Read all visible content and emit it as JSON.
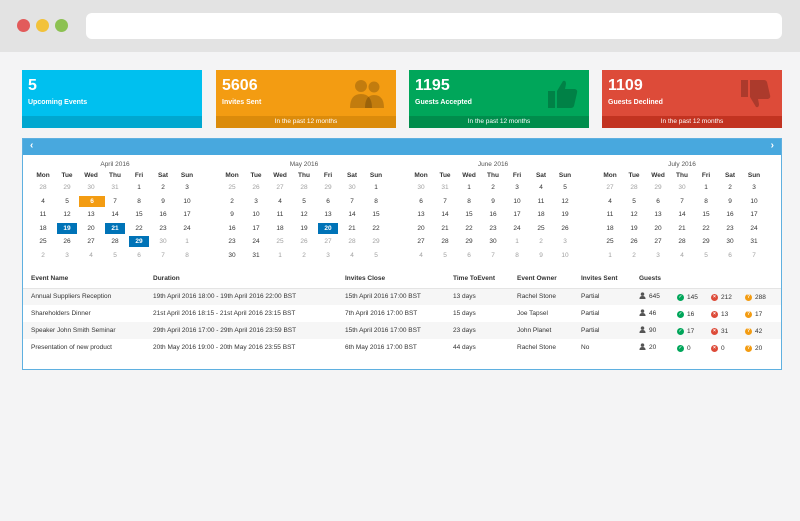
{
  "stats": [
    {
      "value": "5",
      "label": "Upcoming Events",
      "footer": ""
    },
    {
      "value": "5606",
      "label": "Invites Sent",
      "footer": "In the past 12 months",
      "icon": "users-icon"
    },
    {
      "value": "1195",
      "label": "Guests Accepted",
      "footer": "In the past 12 months",
      "icon": "thumbs-up-icon"
    },
    {
      "value": "1109",
      "label": "Guests Declined",
      "footer": "In the past 12 months",
      "icon": "thumbs-down-icon"
    }
  ],
  "nav": {
    "prev": "‹",
    "next": "›"
  },
  "weekdays": [
    "Mon",
    "Tue",
    "Wed",
    "Thu",
    "Fri",
    "Sat",
    "Sun"
  ],
  "calendars": [
    {
      "title": "April 2016",
      "weeks": [
        [
          "28",
          "29",
          "30",
          "31",
          "1",
          "2",
          "3"
        ],
        [
          "4",
          "5",
          "6",
          "7",
          "8",
          "9",
          "10"
        ],
        [
          "11",
          "12",
          "13",
          "14",
          "15",
          "16",
          "17"
        ],
        [
          "18",
          "19",
          "20",
          "21",
          "22",
          "23",
          "24"
        ],
        [
          "25",
          "26",
          "27",
          "28",
          "29",
          "30",
          "1"
        ],
        [
          "2",
          "3",
          "4",
          "5",
          "6",
          "7",
          "8"
        ]
      ]
    },
    {
      "title": "May 2016",
      "weeks": [
        [
          "25",
          "26",
          "27",
          "28",
          "29",
          "30",
          "1"
        ],
        [
          "2",
          "3",
          "4",
          "5",
          "6",
          "7",
          "8"
        ],
        [
          "9",
          "10",
          "11",
          "12",
          "13",
          "14",
          "15"
        ],
        [
          "16",
          "17",
          "18",
          "19",
          "20",
          "21",
          "22"
        ],
        [
          "23",
          "24",
          "25",
          "26",
          "27",
          "28",
          "29"
        ],
        [
          "30",
          "31",
          "1",
          "2",
          "3",
          "4",
          "5"
        ]
      ]
    },
    {
      "title": "June 2016",
      "weeks": [
        [
          "30",
          "31",
          "1",
          "2",
          "3",
          "4",
          "5"
        ],
        [
          "6",
          "7",
          "8",
          "9",
          "10",
          "11",
          "12"
        ],
        [
          "13",
          "14",
          "15",
          "16",
          "17",
          "18",
          "19"
        ],
        [
          "20",
          "21",
          "22",
          "23",
          "24",
          "25",
          "26"
        ],
        [
          "27",
          "28",
          "29",
          "30",
          "1",
          "2",
          "3"
        ],
        [
          "4",
          "5",
          "6",
          "7",
          "8",
          "9",
          "10"
        ]
      ]
    },
    {
      "title": "July 2016",
      "weeks": [
        [
          "27",
          "28",
          "29",
          "30",
          "1",
          "2",
          "3"
        ],
        [
          "4",
          "5",
          "6",
          "7",
          "8",
          "9",
          "10"
        ],
        [
          "11",
          "12",
          "13",
          "14",
          "15",
          "16",
          "17"
        ],
        [
          "18",
          "19",
          "20",
          "21",
          "22",
          "23",
          "24"
        ],
        [
          "25",
          "26",
          "27",
          "28",
          "29",
          "30",
          "31"
        ],
        [
          "1",
          "2",
          "3",
          "4",
          "5",
          "6",
          "7"
        ]
      ]
    }
  ],
  "events": {
    "headers": [
      "Event Name",
      "Duration",
      "Invites Close",
      "Time ToEvent",
      "Event Owner",
      "Invites Sent",
      "Guests"
    ],
    "rows": [
      {
        "name": "Annual Suppliers Reception",
        "duration": "19th April 2016 18:00 - 19th April 2016 22:00 BST",
        "close": "15th April 2016 17:00 BST",
        "time": "13 days",
        "owner": "Rachel Stone",
        "sent": "Partial",
        "invited": "645",
        "accepted": "145",
        "declined": "212",
        "pending": "288"
      },
      {
        "name": "Shareholders Dinner",
        "duration": "21st April 2016 18:15 - 21st April 2016 23:15 BST",
        "close": "7th April 2016 17:00 BST",
        "time": "15 days",
        "owner": "Joe Tapsel",
        "sent": "Partial",
        "invited": "46",
        "accepted": "16",
        "declined": "13",
        "pending": "17"
      },
      {
        "name": "Speaker John Smith Seminar",
        "duration": "29th April 2016 17:00 - 29th April 2016 23:59 BST",
        "close": "15th April 2016 17:00 BST",
        "time": "23 days",
        "owner": "John Planet",
        "sent": "Partial",
        "invited": "90",
        "accepted": "17",
        "declined": "31",
        "pending": "42"
      },
      {
        "name": "Presentation of new product",
        "duration": "20th May 2016 19:00 - 20th May 2016 23:55 BST",
        "close": "6th May 2016 17:00 BST",
        "time": "44 days",
        "owner": "Rachel Stone",
        "sent": "No",
        "invited": "20",
        "accepted": "0",
        "declined": "0",
        "pending": "20"
      }
    ]
  }
}
